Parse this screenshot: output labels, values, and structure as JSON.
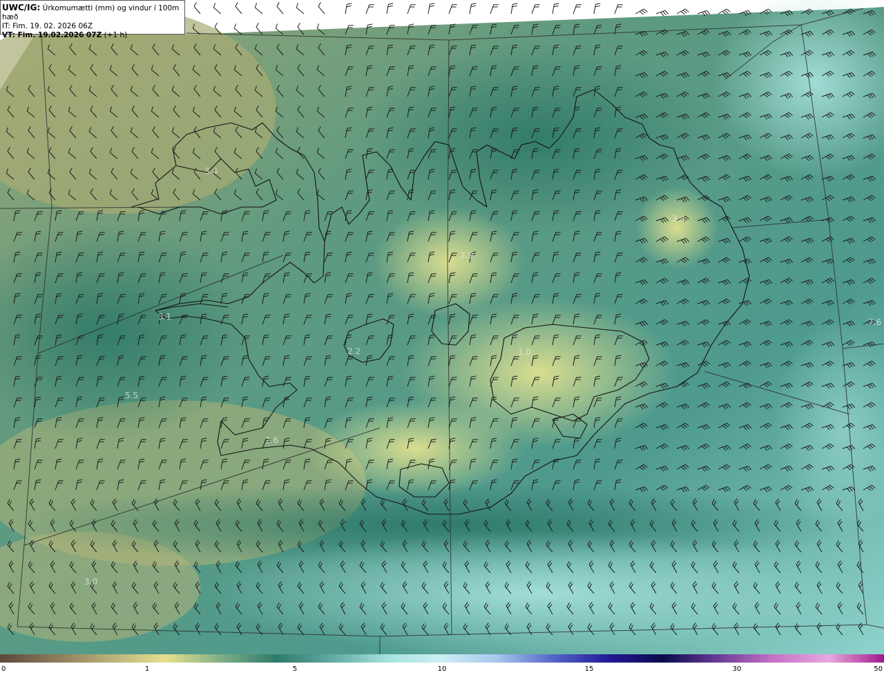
{
  "header": {
    "title_code": "UWC/IG:",
    "title_text": "Úrkomumætti (mm) og vindur í 100m hæð",
    "it_line": "IT: Fim. 19. 02. 2026 06Z",
    "vt_label": "VT: Fim. 19.02.2026 07Z",
    "vt_offset": "(+1 h)"
  },
  "map": {
    "field": "precipitable water (mm)",
    "values_shown": [
      {
        "name": "westfjords",
        "text": "3.4"
      },
      {
        "name": "north-central",
        "text": "2.9"
      },
      {
        "name": "northeast",
        "text": "3.4"
      },
      {
        "name": "snaefellsnes",
        "text": "3.1"
      },
      {
        "name": "langjokull",
        "text": "2.2"
      },
      {
        "name": "vatnajokull",
        "text": "1.0"
      },
      {
        "name": "west-sea",
        "text": "5.5"
      },
      {
        "name": "reykjanes",
        "text": "2.6"
      },
      {
        "name": "east-sea",
        "text": "7.6"
      },
      {
        "name": "southwest-sea",
        "text": "3.0"
      }
    ],
    "wind_barbs": true,
    "coastline": true,
    "graticule": true
  },
  "colorbar": {
    "ticks": [
      "0",
      "1",
      "5",
      "10",
      "15",
      "30",
      "50"
    ],
    "colors": [
      "#5b4a3a",
      "#8c7a58",
      "#b9b07a",
      "#e6e08e",
      "#7fae86",
      "#2e7a6a",
      "#5fa9a2",
      "#a6e2dc",
      "#cdeef5",
      "#a7c6ee",
      "#5567c9",
      "#241a96",
      "#0a0a4c",
      "#6b3b97",
      "#c572c7",
      "#e7a8df",
      "#a21a8c"
    ]
  }
}
